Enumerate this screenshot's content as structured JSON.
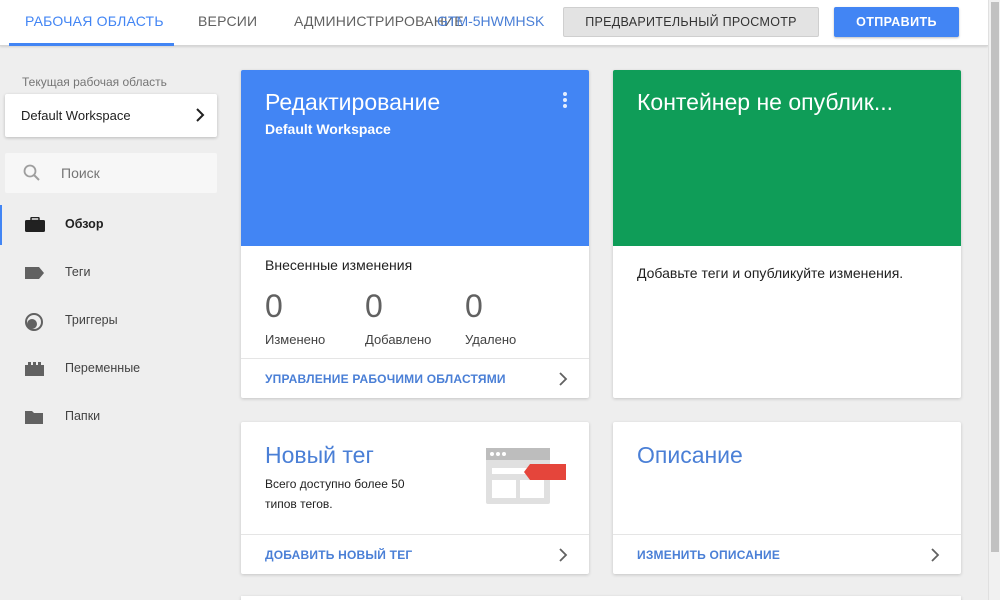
{
  "header": {
    "tabs": [
      {
        "label": "РАБОЧАЯ ОБЛАСТЬ",
        "active": true
      },
      {
        "label": "ВЕРСИИ",
        "active": false
      },
      {
        "label": "АДМИНИСТРИРОВАНИЕ",
        "active": false
      }
    ],
    "container_id": "GTM-5HWMHSK",
    "preview_label": "ПРЕДВАРИТЕЛЬНЫЙ ПРОСМОТР",
    "submit_label": "ОТПРАВИТЬ"
  },
  "sidebar": {
    "workspace_label": "Текущая рабочая область",
    "workspace_name": "Default Workspace",
    "search_placeholder": "Поиск",
    "items": [
      {
        "label": "Обзор",
        "icon": "briefcase-icon",
        "active": true
      },
      {
        "label": "Теги",
        "icon": "tag-icon",
        "active": false
      },
      {
        "label": "Триггеры",
        "icon": "trigger-icon",
        "active": false
      },
      {
        "label": "Переменные",
        "icon": "variables-icon",
        "active": false
      },
      {
        "label": "Папки",
        "icon": "folder-icon",
        "active": false
      }
    ]
  },
  "cards": {
    "editing": {
      "title": "Редактирование",
      "subtitle": "Default Workspace",
      "changes_label": "Внесенные изменения",
      "stats": [
        {
          "value": "0",
          "label": "Изменено"
        },
        {
          "value": "0",
          "label": "Добавлено"
        },
        {
          "value": "0",
          "label": "Удалено"
        }
      ],
      "footer": "УПРАВЛЕНИЕ РАБОЧИМИ ОБЛАСТЯМИ",
      "color": "#4285f4"
    },
    "container": {
      "title": "Контейнер не опублик...",
      "text": "Добавьте теги и опубликуйте изменения.",
      "color": "#0f9d58"
    },
    "new_tag": {
      "title": "Новый тег",
      "text": "Всего доступно более 50 типов тегов.",
      "footer": "ДОБАВИТЬ НОВЫЙ ТЕГ"
    },
    "description": {
      "title": "Описание",
      "footer": "ИЗМЕНИТЬ ОПИСАНИЕ"
    }
  }
}
